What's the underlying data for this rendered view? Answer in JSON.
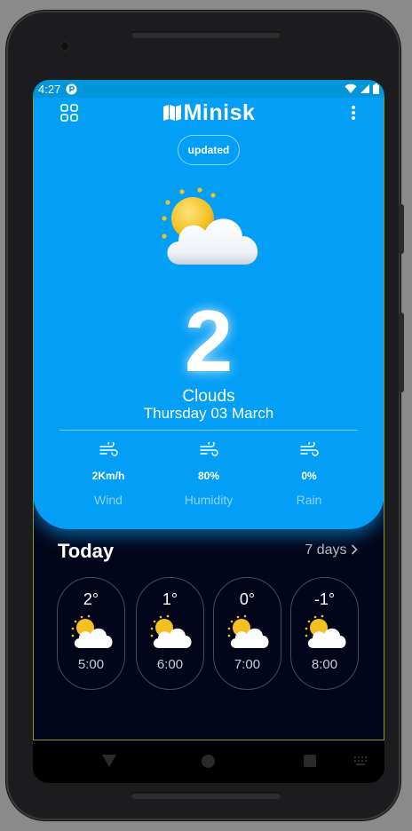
{
  "status_bar": {
    "time": "4:27",
    "notification_icon": "p-badge-icon",
    "wifi_icon": "wifi-icon",
    "signal_icon": "signal-icon",
    "battery_icon": "battery-icon"
  },
  "header": {
    "title": "Minisk",
    "logo_icon": "map-icon",
    "left_button_icon": "grid-icon",
    "right_button_icon": "more-vertical-icon"
  },
  "updated_label": "updated",
  "current": {
    "temperature": "2",
    "condition": "Clouds",
    "date": "Thursday 03 March",
    "icon": "sun-cloud-icon"
  },
  "stats": [
    {
      "icon": "wind-icon",
      "value": "2Km/h",
      "label": "Wind"
    },
    {
      "icon": "wind-icon",
      "value": "80%",
      "label": "Humidity"
    },
    {
      "icon": "wind-icon",
      "value": "0%",
      "label": "Rain"
    }
  ],
  "today": {
    "title": "Today",
    "link_label": "7 days",
    "link_icon": "chevron-right-icon",
    "hours": [
      {
        "temp": "2°",
        "time": "5:00",
        "icon": "sun-cloud-icon"
      },
      {
        "temp": "1°",
        "time": "6:00",
        "icon": "sun-cloud-icon"
      },
      {
        "temp": "0°",
        "time": "7:00",
        "icon": "sun-cloud-icon"
      },
      {
        "temp": "-1°",
        "time": "8:00",
        "icon": "sun-cloud-icon"
      }
    ]
  },
  "colors": {
    "hero_blue": "#039ef6",
    "status_blue": "#0396d8",
    "background_dark": "#03061a",
    "sun_yellow": "#f4c020"
  }
}
